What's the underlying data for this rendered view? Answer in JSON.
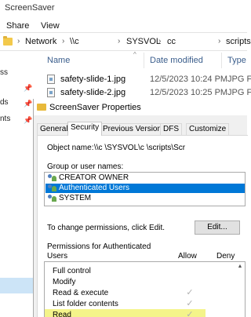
{
  "explorer": {
    "title": "ScreenSaver",
    "menu": [
      "Share",
      "View"
    ],
    "address": {
      "network": "Network",
      "host": "\\\\c",
      "sysvol": "SYSVOL",
      "domain": "cc",
      "scripts": "scripts"
    },
    "columns": {
      "name": "Name",
      "date": "Date modified",
      "type": "Type"
    },
    "nav_items": [
      "ss",
      "ds",
      "nts"
    ],
    "files": [
      {
        "name": "safety-slide-1.jpg",
        "date": "12/5/2023 10:24 PM",
        "type": "JPG File"
      },
      {
        "name": "safety-slide-2.jpg",
        "date": "12/5/2023 10:25 PM",
        "type": "JPG File"
      }
    ]
  },
  "dialog": {
    "title": "ScreenSaver Properties",
    "tabs": [
      "General",
      "Security",
      "Previous Versions",
      "DFS",
      "Customize"
    ],
    "active_tab": "Security",
    "object_name_label": "Object name:",
    "object_name_value": "\\\\c                    \\SYSVOL\\c                   \\scripts\\Scr",
    "group_label": "Group or user names:",
    "groups": [
      "CREATOR OWNER",
      "Authenticated Users",
      "SYSTEM"
    ],
    "selected_group": "Authenticated Users",
    "change_text": "To change permissions, click Edit.",
    "edit_button": "Edit...",
    "perm_for": "Permissions for Authenticated",
    "perm_users": "Users",
    "allow_label": "Allow",
    "deny_label": "Deny",
    "permissions": [
      {
        "name": "Full control",
        "allow": "",
        "deny": ""
      },
      {
        "name": "Modify",
        "allow": "",
        "deny": ""
      },
      {
        "name": "Read & execute",
        "allow": "✓",
        "deny": ""
      },
      {
        "name": "List folder contents",
        "allow": "✓",
        "deny": ""
      },
      {
        "name": "Read",
        "allow": "✓",
        "deny": "",
        "highlighted": true
      }
    ]
  },
  "colors": {
    "selection": "#0078d7",
    "highlight": "#f4f48a",
    "header_text": "#3b5e8c"
  }
}
